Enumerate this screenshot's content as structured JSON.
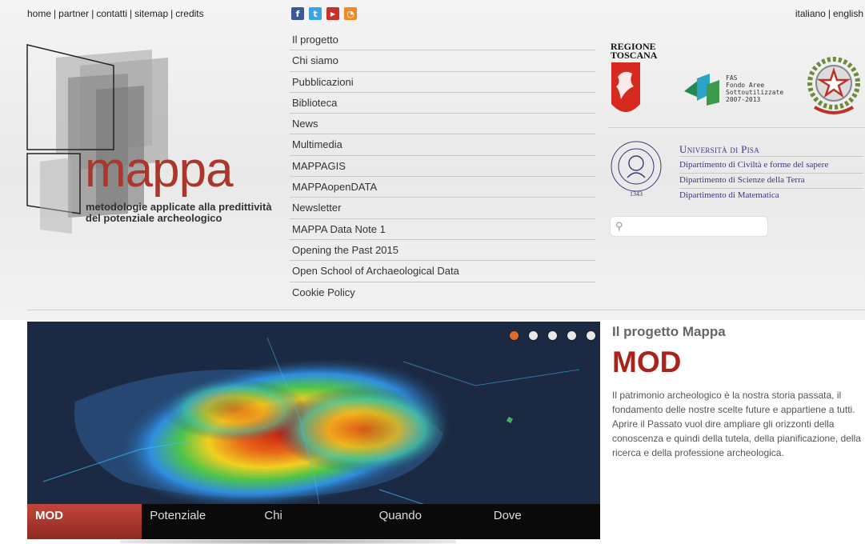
{
  "top_links": [
    "home",
    "partner",
    "contatti",
    "sitemap",
    "credits"
  ],
  "social": [
    {
      "icon": "facebook-icon",
      "glyph": "f",
      "color": "#3b5998"
    },
    {
      "icon": "twitter-icon",
      "glyph": "t",
      "color": "#3aa3e3"
    },
    {
      "icon": "youtube-icon",
      "glyph": "▶",
      "color": "#c8302b"
    },
    {
      "icon": "rss-icon",
      "glyph": "◔",
      "color": "#f08a24"
    }
  ],
  "languages": {
    "italiano": "italiano",
    "english": "english"
  },
  "logo": {
    "word": "mappa",
    "subtitle_1": "metodologie applicate alla predittività",
    "subtitle_2": "del potenziale archeologico"
  },
  "nav": [
    "Il progetto",
    "Chi siamo",
    "Pubblicazioni",
    "Biblioteca",
    "News",
    "Multimedia",
    "MAPPAGIS",
    "MAPPAopenDATA",
    "Newsletter",
    "MAPPA Data Note 1",
    "Opening the Past 2015",
    "Open School of Archaeological Data",
    "Cookie Policy"
  ],
  "sponsors": {
    "regione_1": "REGIONE",
    "regione_2": "TOSCANA",
    "fas": [
      "FAS",
      "Fondo Aree",
      "Sottoutilizzate",
      "2007-2013"
    ],
    "seal_text": "IN SUPREMÆ DIGNITATIS",
    "seal_year": "1343",
    "unipi": "Università di Pisa",
    "departments": [
      "Dipartimento di Civiltà e forme del sapere",
      "Dipartimento di Scienze della Terra",
      "Dipartimento di Matematica"
    ]
  },
  "search": {
    "placeholder": ""
  },
  "slider": {
    "tabs": [
      "MOD",
      "Potenziale",
      "Chi",
      "Quando",
      "Dove"
    ],
    "active_tab": 0,
    "dots": 5,
    "active_dot": 0
  },
  "intro": {
    "kicker": "Il progetto Mappa",
    "title": "MOD",
    "body": "Il patrimonio archeologico è la nostra storia passata, il fondamento delle nostre scelte future e appartiene a tutti. Aprire il Passato vuol dire ampliare gli orizzonti della conoscenza e quindi della tutela, della pianificazione, della ricerca e della professione archeologica."
  }
}
